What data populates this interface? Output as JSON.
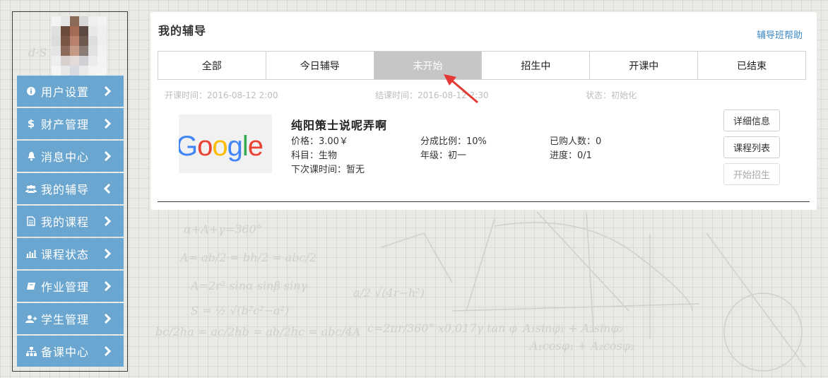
{
  "sidebar": {
    "items": [
      {
        "label": "用户设置",
        "icon": "info-icon"
      },
      {
        "label": "财产管理",
        "icon": "dollar-icon"
      },
      {
        "label": "消息中心",
        "icon": "bell-icon"
      },
      {
        "label": "我的辅导",
        "icon": "users-icon",
        "expanded": true
      },
      {
        "label": "我的课程",
        "icon": "document-icon"
      },
      {
        "label": "课程状态",
        "icon": "bar-chart-icon"
      },
      {
        "label": "作业管理",
        "icon": "book-icon"
      },
      {
        "label": "学生管理",
        "icon": "add-user-icon"
      },
      {
        "label": "备课中心",
        "icon": "sitemap-icon"
      }
    ]
  },
  "main": {
    "title": "我的辅导",
    "help_link": "辅导班帮助",
    "tabs": [
      {
        "label": "全部"
      },
      {
        "label": "今日辅导"
      },
      {
        "label": "未开始",
        "active": true
      },
      {
        "label": "招生中"
      },
      {
        "label": "开课中"
      },
      {
        "label": "已结束"
      }
    ],
    "meta": {
      "start": "开课时间：2016-08-12 2:00",
      "end": "结课时间：2016-08-12 2:30",
      "status": "状态：初始化"
    },
    "course": {
      "logo_text": "Google",
      "name": "纯阳策士说呢弄啊",
      "price": "价格：3.00￥",
      "share": "分成比例：10%",
      "buyers": "已购人数：0",
      "subject": "科目：生物",
      "grade": "年级：初一",
      "progress": "进度：0/1",
      "next_class": "下次课时间：暂无"
    },
    "buttons": {
      "details": "详细信息",
      "course_list": "课程列表",
      "start_enroll": "开始招生"
    }
  },
  "colors": {
    "sidebar_item": "#6aa6cf",
    "active_tab": "#c6c6c6",
    "link": "#3b8ac4",
    "annotation_arrow": "#e53935"
  }
}
